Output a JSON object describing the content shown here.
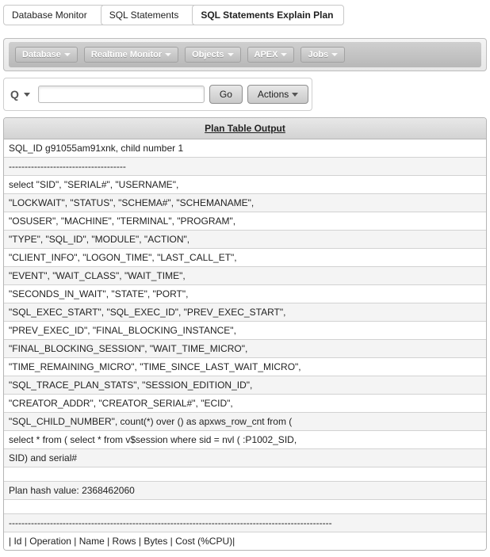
{
  "breadcrumbs": {
    "items": [
      "Database Monitor",
      "SQL Statements",
      "SQL Statements Explain Plan"
    ]
  },
  "menubar": {
    "items": [
      "Database",
      "Realtime Monitor",
      "Objects",
      "APEX",
      "Jobs"
    ]
  },
  "search": {
    "go_label": "Go",
    "actions_label": "Actions",
    "value": ""
  },
  "plan": {
    "header": "Plan Table Output",
    "rows": [
      "SQL_ID g91055am91xnk, child number 1",
      "-------------------------------------",
      "select \"SID\", \"SERIAL#\", \"USERNAME\",",
      "\"LOCKWAIT\", \"STATUS\", \"SCHEMA#\", \"SCHEMANAME\",",
      "\"OSUSER\", \"MACHINE\", \"TERMINAL\", \"PROGRAM\",",
      "\"TYPE\", \"SQL_ID\", \"MODULE\", \"ACTION\",",
      "\"CLIENT_INFO\", \"LOGON_TIME\", \"LAST_CALL_ET\",",
      "\"EVENT\", \"WAIT_CLASS\", \"WAIT_TIME\",",
      "\"SECONDS_IN_WAIT\", \"STATE\", \"PORT\",",
      "\"SQL_EXEC_START\", \"SQL_EXEC_ID\", \"PREV_EXEC_START\",",
      "\"PREV_EXEC_ID\", \"FINAL_BLOCKING_INSTANCE\",",
      "\"FINAL_BLOCKING_SESSION\", \"WAIT_TIME_MICRO\",",
      "\"TIME_REMAINING_MICRO\", \"TIME_SINCE_LAST_WAIT_MICRO\",",
      "\"SQL_TRACE_PLAN_STATS\", \"SESSION_EDITION_ID\",",
      "\"CREATOR_ADDR\", \"CREATOR_SERIAL#\", \"ECID\",",
      "\"SQL_CHILD_NUMBER\", count(*) over () as apxws_row_cnt from (",
      "select * from ( select * from v$session where sid = nvl ( :P1002_SID,",
      "SID) and serial#",
      "",
      "Plan hash value: 2368462060",
      "",
      "------------------------------------------------------------------------------------------------------",
      "| Id | Operation | Name | Rows | Bytes | Cost (%CPU)|"
    ]
  }
}
